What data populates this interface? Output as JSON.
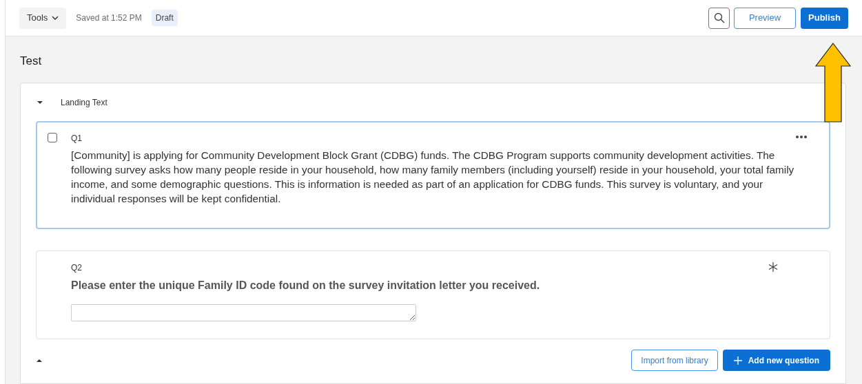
{
  "toolbar": {
    "tools_label": "Tools",
    "saved_text": "Saved at 1:52 PM",
    "status_badge": "Draft",
    "preview_label": "Preview",
    "publish_label": "Publish"
  },
  "survey_title": "Test",
  "block": {
    "title": "Landing Text",
    "expanded": true,
    "questions": [
      {
        "number": "Q1",
        "kind": "text",
        "selected": true,
        "checked": false,
        "required": false,
        "text": "[Community] is applying for Community Development Block Grant (CDBG) funds. The CDBG Program supports community development activities. The following survey asks how many people reside in your household, how many family members (including yourself) reside in your household, your total family income, and some demographic questions. This is information is needed as part of an application for CDBG funds. This survey is voluntary, and your individual responses will be kept confidential."
      },
      {
        "number": "Q2",
        "kind": "entry",
        "selected": false,
        "checked": false,
        "required": true,
        "text": "Please enter the unique Family ID code found on the survey invitation letter you received."
      }
    ],
    "import_label": "Import from library",
    "add_label": "Add new question"
  }
}
